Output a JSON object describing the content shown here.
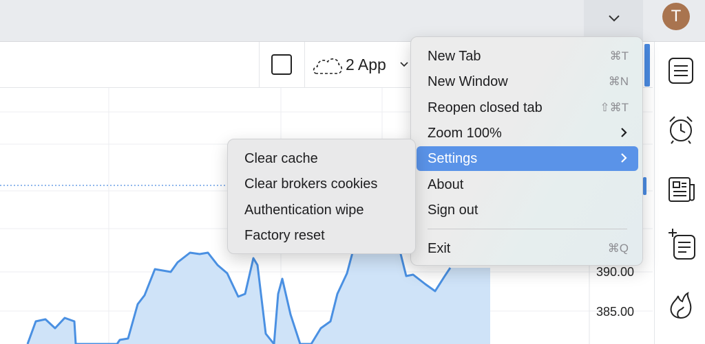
{
  "header": {
    "avatar_letter": "T"
  },
  "chart_toolbar": {
    "app_label": "2 App"
  },
  "chart": {
    "price_labels": [
      "390.00",
      "385.00"
    ],
    "colors": {
      "line": "#4a90e2",
      "fill": "#cfe3f8",
      "grid": "#eceef1",
      "dotted": "#4a8ae0"
    }
  },
  "sidebar": {
    "icons": [
      "list-icon",
      "alarm-clock-icon",
      "newspaper-icon",
      "sparkle-list-icon",
      "flame-icon"
    ]
  },
  "main_menu": {
    "items": [
      {
        "label": "New Tab",
        "shortcut": "⌘T"
      },
      {
        "label": "New Window",
        "shortcut": "⌘N"
      },
      {
        "label": "Reopen closed tab",
        "shortcut": "⇧⌘T"
      },
      {
        "label": "Zoom 100%",
        "shortcut": ""
      },
      {
        "label": "Settings",
        "shortcut": ""
      },
      {
        "label": "About",
        "shortcut": ""
      },
      {
        "label": "Sign out",
        "shortcut": ""
      },
      {
        "label": "Exit",
        "shortcut": "⌘Q"
      }
    ],
    "active": "Settings",
    "accent": "#5a93e8"
  },
  "settings_submenu": {
    "items": [
      {
        "label": "Clear cache"
      },
      {
        "label": "Clear brokers cookies"
      },
      {
        "label": "Authentication wipe"
      },
      {
        "label": "Factory reset"
      }
    ]
  }
}
